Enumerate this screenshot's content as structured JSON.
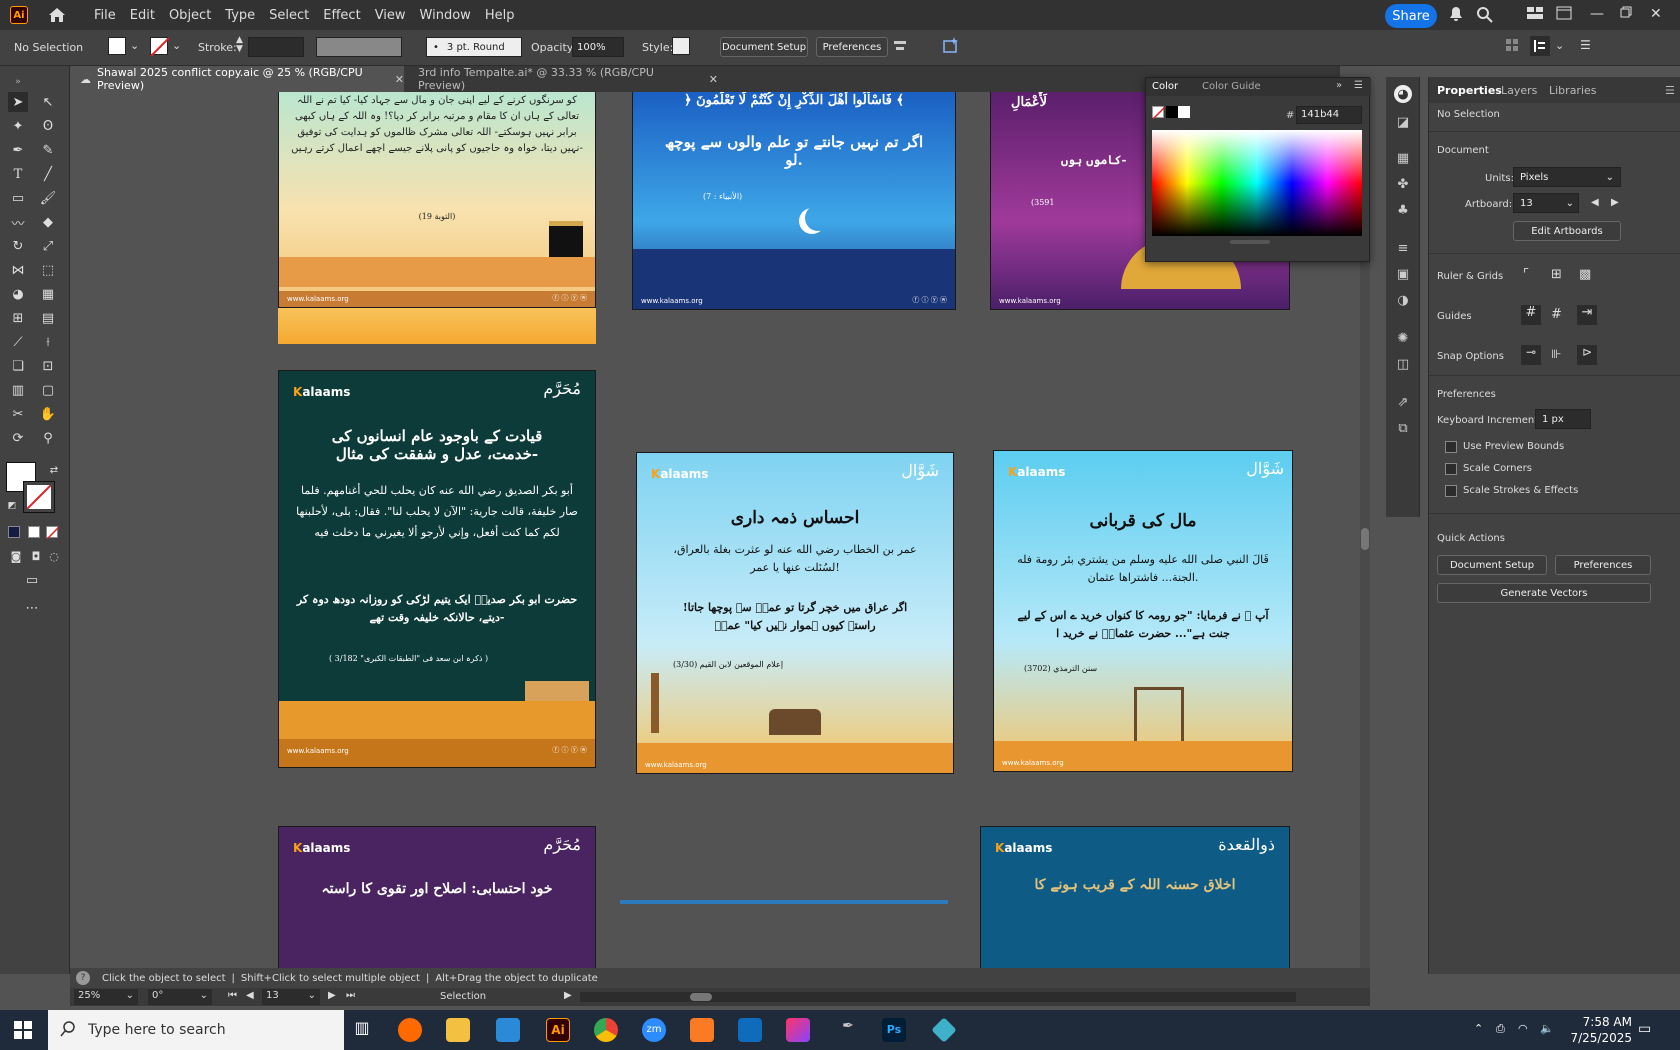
{
  "menubar": {
    "logo": "Ai",
    "items": [
      "File",
      "Edit",
      "Object",
      "Type",
      "Select",
      "Effect",
      "View",
      "Window",
      "Help"
    ],
    "share": "Share"
  },
  "control": {
    "selection": "No Selection",
    "stroke_label": "Stroke:",
    "brush": "3 pt. Round",
    "opacity_label": "Opacity:",
    "opacity_value": "100%",
    "style_label": "Style:",
    "doc_setup": "Document Setup",
    "preferences": "Preferences"
  },
  "tabs": [
    {
      "label": "Shawal 2025 conflict copy.aic @ 25 % (RGB/CPU Preview)"
    },
    {
      "label": "3rd info Tempalte.ai* @ 33.33 % (RGB/CPU Preview)"
    }
  ],
  "color_panel": {
    "tab1": "Color",
    "tab2": "Color Guide",
    "hex_label": "#",
    "hex_value": "141b44"
  },
  "properties": {
    "tabs": [
      "Properties",
      "Layers",
      "Libraries"
    ],
    "selection": "No Selection",
    "document": "Document",
    "units_label": "Units:",
    "units_value": "Pixels",
    "artboard_label": "Artboard:",
    "artboard_value": "13",
    "edit_artboards": "Edit Artboards",
    "rulers": "Ruler & Grids",
    "guides": "Guides",
    "snap": "Snap Options",
    "prefs": "Preferences",
    "kb_label": "Keyboard Increment:",
    "kb_value": "1 px",
    "chk1": "Use Preview Bounds",
    "chk2": "Scale Corners",
    "chk3": "Scale Strokes & Effects",
    "quick": "Quick Actions",
    "qa_doc": "Document Setup",
    "qa_pref": "Preferences",
    "qa_gen": "Generate Vectors"
  },
  "hint": {
    "t1": "Click the object to select",
    "t2": "Shift+Click to select multiple object",
    "t3": "Alt+Drag the object to duplicate"
  },
  "status": {
    "zoom": "25%",
    "rotate": "0°",
    "artboard": "13",
    "mode": "Selection"
  },
  "artboards": {
    "a1": {
      "body": "کو سرنگوں کرنے کے لیے اپنی جان و مال سے جہاد کیا- کیا تم نے اللہ تعالی کے ہاں ان کا مقام و مرتبہ برابر کر دیا؟! وہ اللہ کے ہاں کبھی برابر نہیں ہوسکتے- اللہ تعالی مشرک ظالموں کو ہدایت کی توفیق نہیں دیتا، خواہ وہ حاجیوں کو پانی پلانے جیسے اچھے اعمال کرتے رہیں-",
      "ref": "(التوبة 19)",
      "site": "www.kalaams.org"
    },
    "a2": {
      "ayah": "﴿ فَاسْأَلُوا أَهْلَ الذِّكْرِ إِنْ كُنْتُمْ لَا تَعْلَمُونَ ﴾",
      "body": "اگر تم نہیں جانتے تو علم والوں سے پوچھ لو.",
      "ref": "(الأنبياء : 7)",
      "site": "www.kalaams.org"
    },
    "a3": {
      "ayah": "لَأَعْمَالِ",
      "body": "کاموں ہوں-",
      "ref": "(3591",
      "site": "www.kalaams.org"
    },
    "a4": {
      "brand_k": "K",
      "brand": "alaams",
      "month": "مُحَرَّم",
      "title": "قیادت کے باوجود عام انسانوں کی خدمت، عدل و شفقت کی مثال-",
      "arabic": "أبو بكر الصديق رضي الله عنه كان يحلب للحي أغنامهم. فلما صار خليفة، قالت جارية: \"الآن لا يحلب لنا\". فقال: بلى، لأحلبنها لكم كما كنت أفعل، وإني لأرجو ألا يغيرني ما دخلت فيه",
      "urdu": "حضرت ابو بکر صدیقؓ ایک یتیم لڑکی کو روزانہ دودھ دوہ کر دیتے، حالانکہ خلیفہ وقت تھے-",
      "ref": "( ذکرہ ابن سعد فی \"الطبقات الکبری\" 3/182 )",
      "site": "www.kalaams.org"
    },
    "a5": {
      "brand_k": "K",
      "brand": "alaams",
      "month": "شَوَّال",
      "title": "احساس ذمہ داری",
      "arabic": "عمر بن الخطاب رضي الله عنه لو عثرت بغلة بالعراق، لسُئلت عنها يا عمر!",
      "urdu": "اگر عراق میں خچر گرتا تو عمرؓ سے پوچھا جاتا! راستہ کیوں ہموار نہیں کیا\" عمرؓ",
      "ref": "إعلام الموقعين لابن القيم (3/30)",
      "site": "www.kalaams.org"
    },
    "a6": {
      "brand_k": "K",
      "brand": "alaams",
      "month": "شَوَّال",
      "title": "مال کی قربانی",
      "arabic": "قَالَ النبي صلى الله عليه وسلم من يشتري بئر رومة فله الجنة... فاشتراها عثمان.",
      "urdu": "آپ ﷺ نے فرمایا: \"جو رومہ کا کنواں خرید ے اس کے لیے جنت ہے\"... حضرت عثمانؓ نے خرید ا",
      "ref": "سنن الترمذي (3702)",
      "site": "www.kalaams.org"
    },
    "a7": {
      "brand_k": "K",
      "brand": "alaams",
      "month": "مُحَرَّم",
      "title": "خود احتسابی: اصلاح اور تقوی کا راستہ"
    },
    "a8": {
      "brand_k": "K",
      "brand": "alaams",
      "month": "ذوالقعدة",
      "title": "اخلاق حسنہ اللہ کے قریب ہونے کا"
    }
  },
  "taskbar": {
    "search": "Type here to search",
    "time": "7:58 AM",
    "date": "7/25/2025"
  },
  "colors": {
    "menubar": "#323232",
    "panel": "#424242",
    "canvas": "#535353",
    "share": "#1473e6",
    "accent": "#f7a21a"
  }
}
